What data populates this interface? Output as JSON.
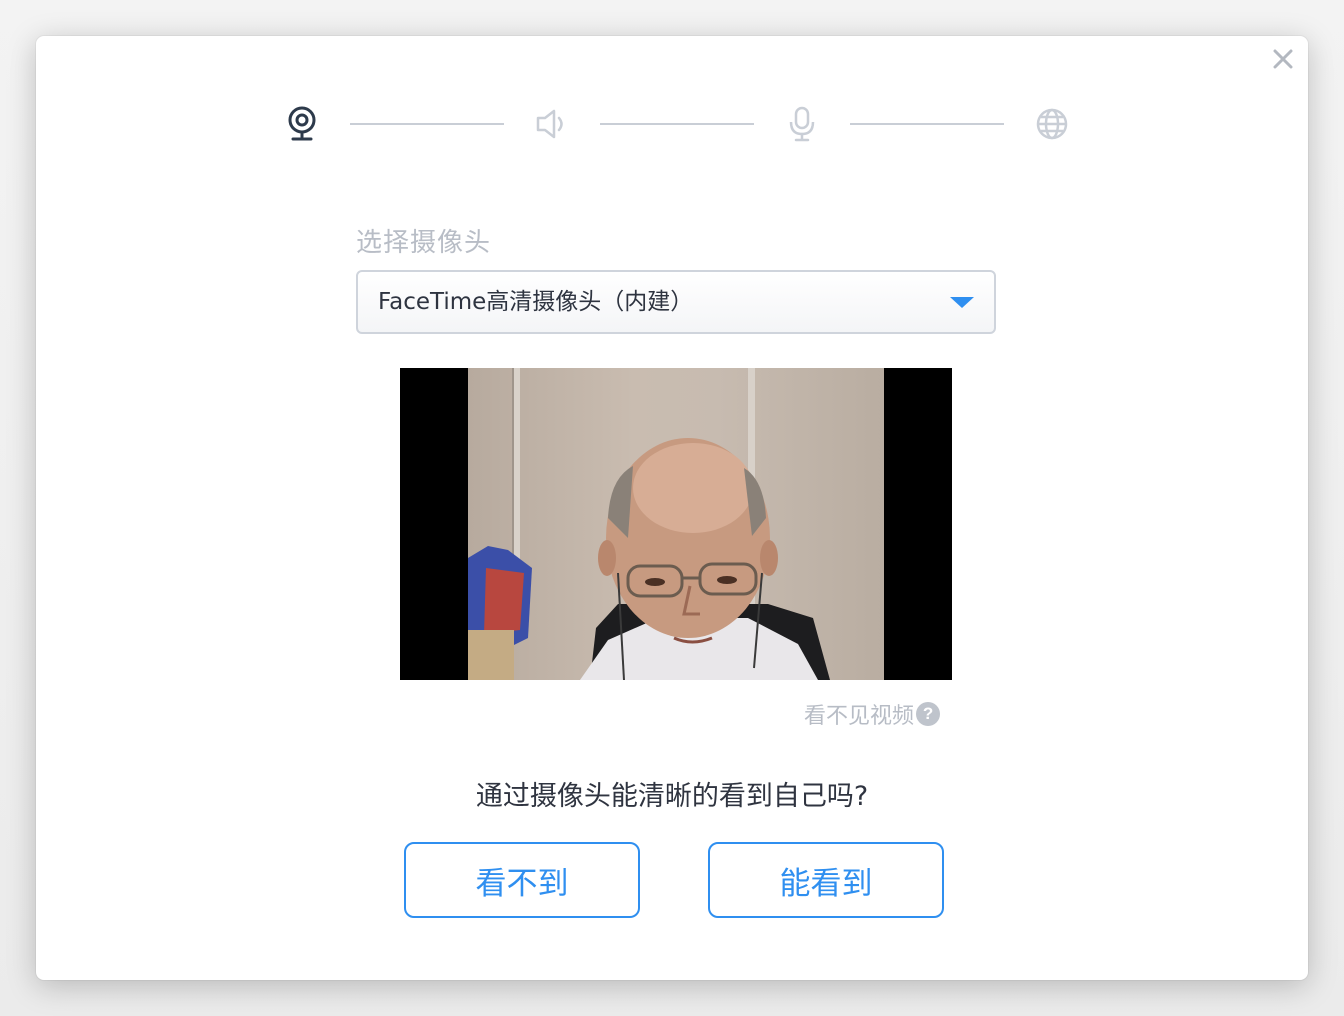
{
  "dialog": {
    "steps": [
      {
        "icon": "webcam-icon",
        "active": true
      },
      {
        "icon": "speaker-icon",
        "active": false
      },
      {
        "icon": "microphone-icon",
        "active": false
      },
      {
        "icon": "globe-icon",
        "active": false
      }
    ],
    "camera_label": "选择摄像头",
    "camera_selected": "FaceTime高清摄像头（内建）",
    "help_text": "看不见视频",
    "help_icon": "?",
    "question": "通过摄像头能清晰的看到自己吗?",
    "cannot_see_label": "看不到",
    "can_see_label": "能看到"
  },
  "colors": {
    "accent": "#2f8ff0",
    "active_icon": "#2d3a4b",
    "inactive_icon": "#c9ced6"
  }
}
